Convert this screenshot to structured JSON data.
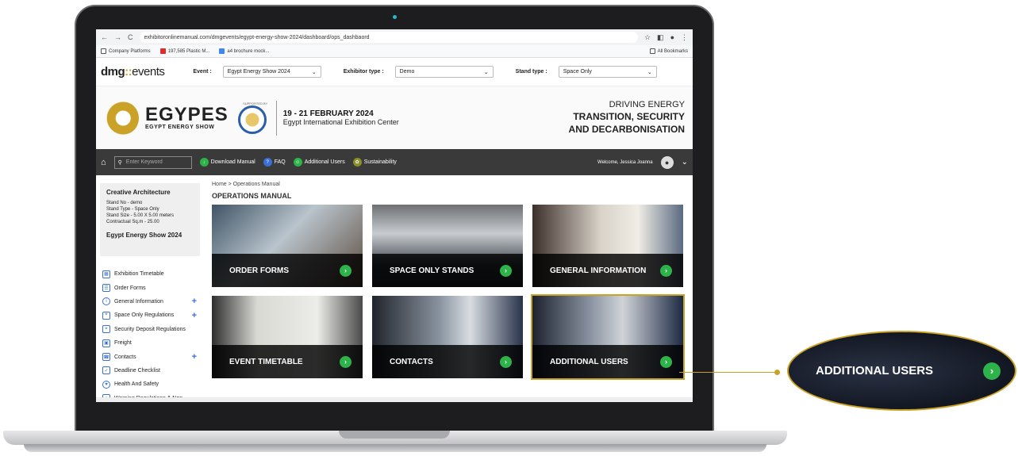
{
  "browser": {
    "url": "exhibitoronlinemanual.com/dmgevents/egypt-energy-show-2024/dashboard/ops_dashbaord",
    "bookmarks": [
      "Company Platforms",
      "197,585 Plastic M...",
      "a4 brochure mock..."
    ],
    "all_bookmarks": "All Bookmarks"
  },
  "filters": {
    "logo_brand": "dmg",
    "logo_sep": "::",
    "logo_word": "events",
    "event_label": "Event :",
    "event_value": "Egypt Energy Show 2024",
    "exhibitor_label": "Exhibitor type :",
    "exhibitor_value": "Demo",
    "stand_label": "Stand type :",
    "stand_value": "Space Only"
  },
  "banner": {
    "title": "EGYPES",
    "subtitle": "EGYPT ENERGY SHOW",
    "supported": "SUPPORTED BY",
    "dates": "19 - 21 FEBRUARY 2024",
    "venue": "Egypt International Exhibition Center",
    "tag1": "DRIVING ENERGY",
    "tag2": "TRANSITION, SECURITY",
    "tag3": "AND DECARBONISATION"
  },
  "nav": {
    "keyword_placeholder": "Enter Keyword",
    "download": "Download Manual",
    "faq": "FAQ",
    "additional_users": "Additional Users",
    "sustainability": "Sustainability",
    "welcome": "Welcome, Jessica Joanna"
  },
  "profile": {
    "company": "Creative Architecture",
    "stand_no": "Stand No - demo",
    "stand_type": "Stand Type - Space Only",
    "stand_size": "Stand Size - 5.00 X 5.00 meters",
    "contractual": "Contractual Sq.m - 25.00",
    "show": "Egypt Energy Show 2024"
  },
  "menu": [
    {
      "label": "Exhibition Timetable",
      "plus": ""
    },
    {
      "label": "Order Forms",
      "plus": ""
    },
    {
      "label": "General Information",
      "plus": "+"
    },
    {
      "label": "Space Only Regulations",
      "plus": "+"
    },
    {
      "label": "Security Deposit Regulations",
      "plus": ""
    },
    {
      "label": "Freight",
      "plus": ""
    },
    {
      "label": "Contacts",
      "plus": "+"
    },
    {
      "label": "Deadline Checklist",
      "plus": ""
    },
    {
      "label": "Health And Safety",
      "plus": ""
    },
    {
      "label": "Warning Regulations & Non-",
      "plus": ""
    }
  ],
  "main": {
    "breadcrumb": "Home > Operations Manual",
    "title": "OPERATIONS MANUAL",
    "cards": [
      {
        "label": "ORDER FORMS"
      },
      {
        "label": "SPACE ONLY STANDS"
      },
      {
        "label": "GENERAL INFORMATION"
      },
      {
        "label": "EVENT TIMETABLE"
      },
      {
        "label": "CONTACTS"
      },
      {
        "label": "ADDITIONAL USERS"
      }
    ]
  },
  "callout": {
    "label": "ADDITIONAL USERS"
  },
  "colors": {
    "accent_gold": "#c9a227",
    "go_green": "#2db34a",
    "nav_dark": "#3a3a3a"
  }
}
